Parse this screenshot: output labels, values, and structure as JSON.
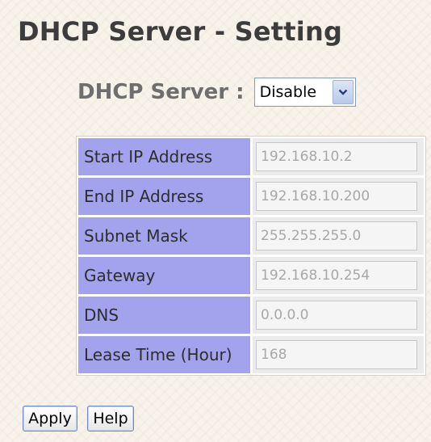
{
  "page": {
    "title": "DHCP Server - Setting"
  },
  "dhcp_server": {
    "label": "DHCP Server :",
    "selected": "Disable"
  },
  "settings": [
    {
      "label": "Start IP Address",
      "value": "192.168.10.2"
    },
    {
      "label": "End IP Address",
      "value": "192.168.10.200"
    },
    {
      "label": "Subnet Mask",
      "value": "255.255.255.0"
    },
    {
      "label": "Gateway",
      "value": "192.168.10.254"
    },
    {
      "label": "DNS",
      "value": "0.0.0.0"
    },
    {
      "label": "Lease Time (Hour)",
      "value": "168"
    }
  ],
  "buttons": {
    "apply": "Apply",
    "help": "Help"
  },
  "colors": {
    "label_cell_bg": "#a3a3ed",
    "value_cell_bg": "#ebebeb",
    "page_bg": "#f7f2ea",
    "title_text": "#3c3c3c",
    "disabled_text": "#a8a8a8"
  },
  "icons": {
    "dropdown": "chevron-down-icon"
  }
}
